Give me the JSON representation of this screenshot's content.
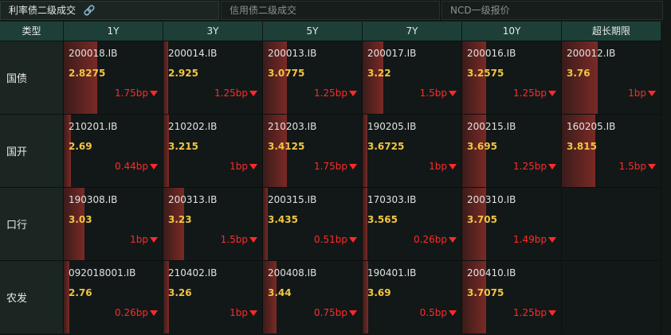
{
  "tabs": [
    {
      "label": "利率债二级成交",
      "active": true
    },
    {
      "label": "信用债二级成交",
      "active": false
    },
    {
      "label": "NCD一级报价",
      "active": false
    }
  ],
  "header": {
    "type_label": "类型",
    "terms": [
      "1Y",
      "3Y",
      "5Y",
      "7Y",
      "10Y",
      "超长期限"
    ]
  },
  "rows": [
    {
      "label": "国债",
      "cells": [
        {
          "code": "200018.IB",
          "yield": "2.8275",
          "change": "1.75bp",
          "bar": 0.34
        },
        {
          "code": "200014.IB",
          "yield": "2.925",
          "change": "1.25bp",
          "bar": 0.05
        },
        {
          "code": "200013.IB",
          "yield": "3.0775",
          "change": "1.25bp",
          "bar": 0.24
        },
        {
          "code": "200017.IB",
          "yield": "3.22",
          "change": "1.5bp",
          "bar": 0.21
        },
        {
          "code": "200016.IB",
          "yield": "3.2575",
          "change": "1.25bp",
          "bar": 0.24
        },
        {
          "code": "200012.IB",
          "yield": "3.76",
          "change": "1bp",
          "bar": 0.36
        }
      ]
    },
    {
      "label": "国开",
      "cells": [
        {
          "code": "210201.IB",
          "yield": "2.69",
          "change": "0.44bp",
          "bar": 0.07
        },
        {
          "code": "210202.IB",
          "yield": "3.215",
          "change": "1bp",
          "bar": 0.06
        },
        {
          "code": "210203.IB",
          "yield": "3.4125",
          "change": "1.75bp",
          "bar": 0.24
        },
        {
          "code": "190205.IB",
          "yield": "3.6725",
          "change": "1bp",
          "bar": 0.05
        },
        {
          "code": "200215.IB",
          "yield": "3.695",
          "change": "1.25bp",
          "bar": 0.24
        },
        {
          "code": "160205.IB",
          "yield": "3.815",
          "change": "1.5bp",
          "bar": 0.34
        }
      ]
    },
    {
      "label": "口行",
      "cells": [
        {
          "code": "190308.IB",
          "yield": "3.03",
          "change": "1bp",
          "bar": 0.21
        },
        {
          "code": "200313.IB",
          "yield": "3.23",
          "change": "1.5bp",
          "bar": 0.21
        },
        {
          "code": "200315.IB",
          "yield": "3.435",
          "change": "0.51bp",
          "bar": 0.05
        },
        {
          "code": "170303.IB",
          "yield": "3.565",
          "change": "0.26bp",
          "bar": 0.05
        },
        {
          "code": "200310.IB",
          "yield": "3.705",
          "change": "1.49bp",
          "bar": 0.24
        },
        null
      ]
    },
    {
      "label": "农发",
      "cells": [
        {
          "code": "092018001.IB",
          "yield": "2.76",
          "change": "0.26bp",
          "bar": 0.06
        },
        {
          "code": "210402.IB",
          "yield": "3.26",
          "change": "1bp",
          "bar": 0.06
        },
        {
          "code": "200408.IB",
          "yield": "3.44",
          "change": "0.75bp",
          "bar": 0.14
        },
        {
          "code": "190401.IB",
          "yield": "3.69",
          "change": "0.5bp",
          "bar": 0.06
        },
        {
          "code": "200410.IB",
          "yield": "3.7075",
          "change": "1.25bp",
          "bar": 0.24
        },
        null
      ]
    }
  ],
  "colors": {
    "header_bg": "#1d3f38",
    "yield": "#f2c542",
    "change_down": "#ff2a2a",
    "bar": "#7a2a26"
  },
  "icons": {
    "tab_link": "link-icon",
    "change_direction": "down-triangle-icon"
  }
}
